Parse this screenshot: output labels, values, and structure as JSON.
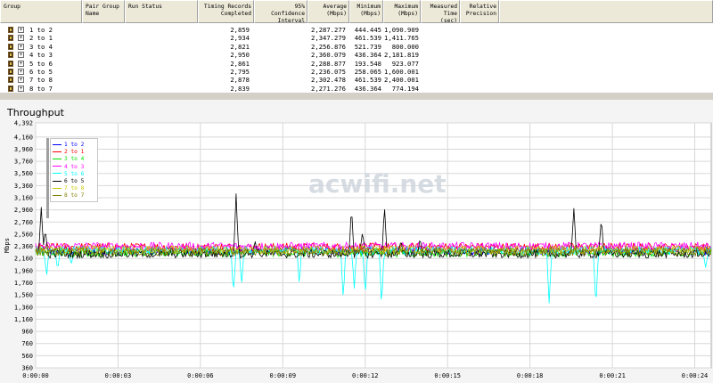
{
  "table": {
    "headers": [
      {
        "label": "Group",
        "align": "l"
      },
      {
        "label": "Pair Group\nName",
        "align": "l"
      },
      {
        "label": "Run Status",
        "align": "l"
      },
      {
        "label": "Timing Records\nCompleted",
        "align": "r"
      },
      {
        "label": "95% Confidence\nInterval",
        "align": "r"
      },
      {
        "label": "Average\n(Mbps)",
        "align": "r"
      },
      {
        "label": "Minimum\n(Mbps)",
        "align": "r"
      },
      {
        "label": "Maximum\n(Mbps)",
        "align": "r"
      },
      {
        "label": "Measured\nTime (sec)",
        "align": "r"
      },
      {
        "label": "Relative\nPrecision",
        "align": "r"
      }
    ],
    "rows": [
      {
        "group": "1 to 2",
        "records": "2,859",
        "avg": "2,287.277",
        "min": "444.445",
        "max": "1,090.909"
      },
      {
        "group": "2 to 1",
        "records": "2,934",
        "avg": "2,347.279",
        "min": "461.539",
        "max": "1,411.765"
      },
      {
        "group": "3 to 4",
        "records": "2,821",
        "avg": "2,256.876",
        "min": "521.739",
        "max": "800.000"
      },
      {
        "group": "4 to 3",
        "records": "2,950",
        "avg": "2,360.079",
        "min": "436.364",
        "max": "2,181.819"
      },
      {
        "group": "5 to 6",
        "records": "2,861",
        "avg": "2,288.877",
        "min": "193.548",
        "max": "923.077"
      },
      {
        "group": "6 to 5",
        "records": "2,795",
        "avg": "2,236.075",
        "min": "258.065",
        "max": "1,600.001"
      },
      {
        "group": "7 to 8",
        "records": "2,878",
        "avg": "2,302.478",
        "min": "461.539",
        "max": "2,400.001"
      },
      {
        "group": "8 to 7",
        "records": "2,839",
        "avg": "2,271.276",
        "min": "436.364",
        "max": "774.194"
      }
    ]
  },
  "panel": {
    "title": "Throughput",
    "watermark": "acwifi.net"
  },
  "chart_data": {
    "type": "line",
    "ylabel": "Mbps",
    "ylim": [
      360,
      4392
    ],
    "xlim_seconds": [
      0,
      24.6
    ],
    "yticks": [
      "4,392",
      "4,160",
      "3,960",
      "3,760",
      "3,560",
      "3,360",
      "3,160",
      "2,960",
      "2,760",
      "2,560",
      "2,360",
      "2,160",
      "1,960",
      "1,760",
      "1,560",
      "1,360",
      "1,160",
      "960",
      "760",
      "560",
      "360"
    ],
    "ytick_values": [
      4392,
      4160,
      3960,
      3760,
      3560,
      3360,
      3160,
      2960,
      2760,
      2560,
      2360,
      2160,
      1960,
      1760,
      1560,
      1360,
      1160,
      960,
      760,
      560,
      360
    ],
    "xticks": [
      "0:00:00",
      "0:00:03",
      "0:00:06",
      "0:00:09",
      "0:00:12",
      "0:00:15",
      "0:00:18",
      "0:00:21",
      "0:00:24"
    ],
    "xtick_values": [
      0,
      3,
      6,
      9,
      12,
      15,
      18,
      21,
      24
    ],
    "grid": true,
    "legend_position": "top-left",
    "series": [
      {
        "name": "1 to 2",
        "color": "#0000ff",
        "base": 2287,
        "spikes": []
      },
      {
        "name": "2 to 1",
        "color": "#ff0000",
        "base": 2347,
        "spikes": []
      },
      {
        "name": "3 to 4",
        "color": "#00e000",
        "base": 2257,
        "spikes": []
      },
      {
        "name": "4 to 3",
        "color": "#ff00ff",
        "base": 2360,
        "spikes": []
      },
      {
        "name": "5 to 6",
        "color": "#00ffff",
        "base": 2289,
        "spikes": [
          [
            0.4,
            1850
          ],
          [
            0.8,
            1950
          ],
          [
            1.3,
            2050
          ],
          [
            7.2,
            1550
          ],
          [
            7.5,
            1750
          ],
          [
            9.6,
            1750
          ],
          [
            11.2,
            1500
          ],
          [
            11.6,
            1650
          ],
          [
            12.0,
            1550
          ],
          [
            12.6,
            1350
          ],
          [
            18.7,
            1390
          ],
          [
            20.4,
            1340
          ],
          [
            24.4,
            2000
          ]
        ]
      },
      {
        "name": "6 to 5",
        "color": "#000000",
        "base": 2236,
        "spikes": [
          [
            0.2,
            3050
          ],
          [
            0.35,
            2650
          ],
          [
            7.3,
            3250
          ],
          [
            8.0,
            2450
          ],
          [
            11.5,
            3030
          ],
          [
            11.9,
            2600
          ],
          [
            12.7,
            3050
          ],
          [
            13.3,
            2450
          ],
          [
            14.0,
            2500
          ],
          [
            19.6,
            3000
          ],
          [
            20.6,
            2850
          ],
          [
            24.3,
            2200
          ]
        ]
      },
      {
        "name": "7 to 8",
        "color": "#c8c800",
        "base": 2302,
        "spikes": []
      },
      {
        "name": "8 to 7",
        "color": "#808000",
        "base": 2271,
        "spikes": []
      }
    ]
  }
}
